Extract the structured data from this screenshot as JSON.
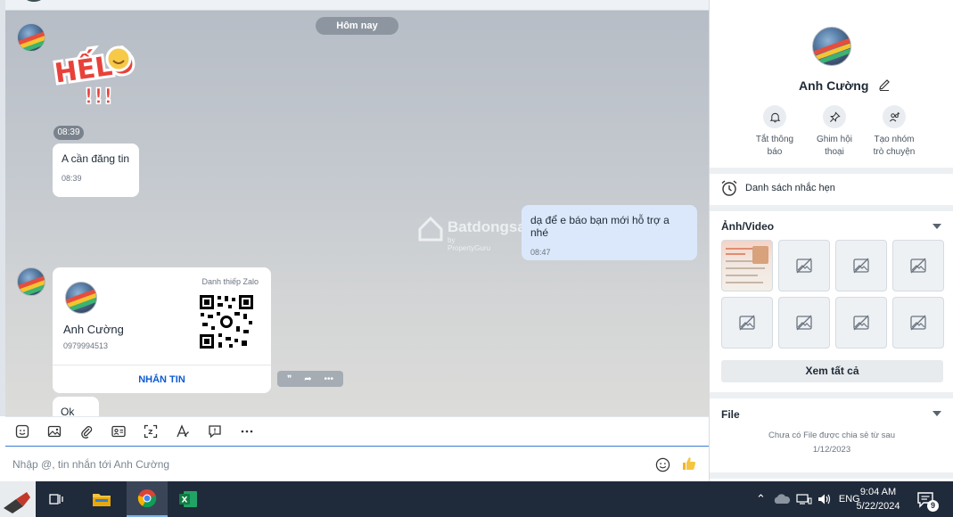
{
  "chat": {
    "date_divider": "Hôm nay",
    "sticker_text": "HẾLÔ",
    "time_stamp": "08:39",
    "messages": [
      {
        "text": "A cần đăng tin",
        "time": "08:39"
      },
      {
        "text": "dạ để e báo bạn mới hỗ trợ a nhé",
        "time": "08:47"
      }
    ],
    "watermark": {
      "main": "Batdongsan",
      "sub": "by PropertyGuru"
    },
    "contact_card": {
      "label": "Danh thiếp Zalo",
      "name": "Anh Cường",
      "phone": "0979994513",
      "button": "NHẮN TIN"
    },
    "ok_message": "Ok"
  },
  "composer": {
    "placeholder": "Nhập @, tin nhắn tới Anh Cường",
    "toolbar_icons": [
      "sticker-icon",
      "image-icon",
      "attach-icon",
      "contact-card-icon",
      "screenshot-icon",
      "format-text-icon",
      "quick-message-icon",
      "more-icon"
    ]
  },
  "sidebar": {
    "name": "Anh Cường",
    "actions": [
      {
        "label_line1": "Tắt thông",
        "label_line2": "báo"
      },
      {
        "label_line1": "Ghim hội",
        "label_line2": "thoại"
      },
      {
        "label_line1": "Tạo nhóm",
        "label_line2": "trò chuyện"
      }
    ],
    "reminder": "Danh sách nhắc hẹn",
    "media_title": "Ảnh/Video",
    "see_all": "Xem tất cả",
    "file_title": "File",
    "file_empty_line1": "Chưa có File được chia sẻ từ sau",
    "file_empty_line2": "1/12/2023"
  },
  "taskbar": {
    "language": "ENG",
    "time": "9:04 AM",
    "date": "5/22/2024",
    "notification_count": "9"
  }
}
